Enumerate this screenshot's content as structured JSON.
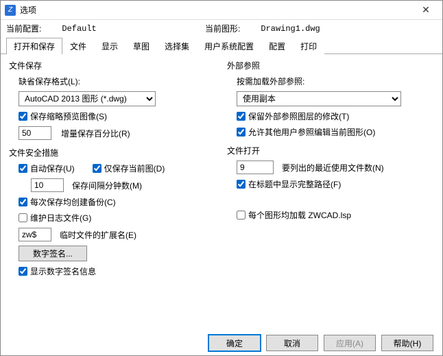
{
  "window": {
    "title": "选项"
  },
  "profile": {
    "current_profile_label": "当前配置:",
    "current_profile_value": "Default",
    "current_drawing_label": "当前图形:",
    "current_drawing_value": "Drawing1.dwg"
  },
  "tabs": [
    {
      "label": "打开和保存",
      "active": true
    },
    {
      "label": "文件",
      "active": false
    },
    {
      "label": "显示",
      "active": false
    },
    {
      "label": "草图",
      "active": false
    },
    {
      "label": "选择集",
      "active": false
    },
    {
      "label": "用户系统配置",
      "active": false
    },
    {
      "label": "配置",
      "active": false
    },
    {
      "label": "打印",
      "active": false
    }
  ],
  "left": {
    "file_save": {
      "title": "文件保存",
      "default_format_label": "缺省保存格式(L):",
      "default_format_value": "AutoCAD 2013 图形 (*.dwg)",
      "save_thumbnail_label": "保存缩略预览图像(S)",
      "save_thumbnail_checked": true,
      "incremental_value": "50",
      "incremental_label": "增量保存百分比(R)"
    },
    "safety": {
      "title": "文件安全措施",
      "autosave_label": "自动保存(U)",
      "autosave_checked": true,
      "only_current_label": "仅保存当前图(D)",
      "only_current_checked": true,
      "interval_value": "10",
      "interval_label": "保存间隔分钟数(M)",
      "backup_label": "每次保存均创建备份(C)",
      "backup_checked": true,
      "log_label": "维护日志文件(G)",
      "log_checked": false,
      "temp_ext_value": "zw$",
      "temp_ext_label": "临时文件的扩展名(E)",
      "digital_sig_button": "数字签名...",
      "show_sig_label": "显示数字签名信息",
      "show_sig_checked": true
    }
  },
  "right": {
    "xref": {
      "title": "外部参照",
      "load_label": "按需加载外部参照:",
      "load_value": "使用副本",
      "retain_layer_label": "保留外部参照图层的修改(T)",
      "retain_layer_checked": true,
      "allow_edit_label": "允许其他用户参照编辑当前图形(O)",
      "allow_edit_checked": true
    },
    "file_open": {
      "title": "文件打开",
      "recent_value": "9",
      "recent_label": "要列出的最近使用文件数(N)",
      "fullpath_label": "在标题中显示完整路径(F)",
      "fullpath_checked": true,
      "load_lsp_label": "每个图形均加载 ZWCAD.lsp",
      "load_lsp_checked": false
    }
  },
  "footer": {
    "ok": "确定",
    "cancel": "取消",
    "apply": "应用(A)",
    "help": "帮助(H)"
  }
}
